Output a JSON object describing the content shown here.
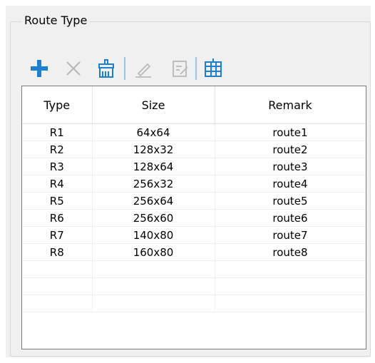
{
  "group": {
    "title": "Route Type"
  },
  "toolbar": {
    "items": [
      {
        "name": "add-icon",
        "enabled": true,
        "color": "#1e7fd0"
      },
      {
        "name": "delete-icon",
        "enabled": false,
        "color": "#b9b9b9"
      },
      {
        "name": "clear-icon",
        "enabled": true,
        "color": "#1e7fd0"
      },
      {
        "name": "edit-icon",
        "enabled": false,
        "color": "#b9b9b9"
      },
      {
        "name": "edit-record-icon",
        "enabled": false,
        "color": "#b9b9b9"
      },
      {
        "name": "table-icon",
        "enabled": true,
        "color": "#1e7fd0"
      }
    ]
  },
  "table": {
    "columns": [
      "Type",
      "Size",
      "Remark"
    ],
    "rows": [
      [
        "R1",
        "64x64",
        "route1"
      ],
      [
        "R2",
        "128x32",
        "route2"
      ],
      [
        "R3",
        "128x64",
        "route3"
      ],
      [
        "R4",
        "256x32",
        "route4"
      ],
      [
        "R5",
        "256x64",
        "route5"
      ],
      [
        "R6",
        "256x60",
        "route6"
      ],
      [
        "R7",
        "140x80",
        "route7"
      ],
      [
        "R8",
        "160x80",
        "route8"
      ]
    ]
  }
}
